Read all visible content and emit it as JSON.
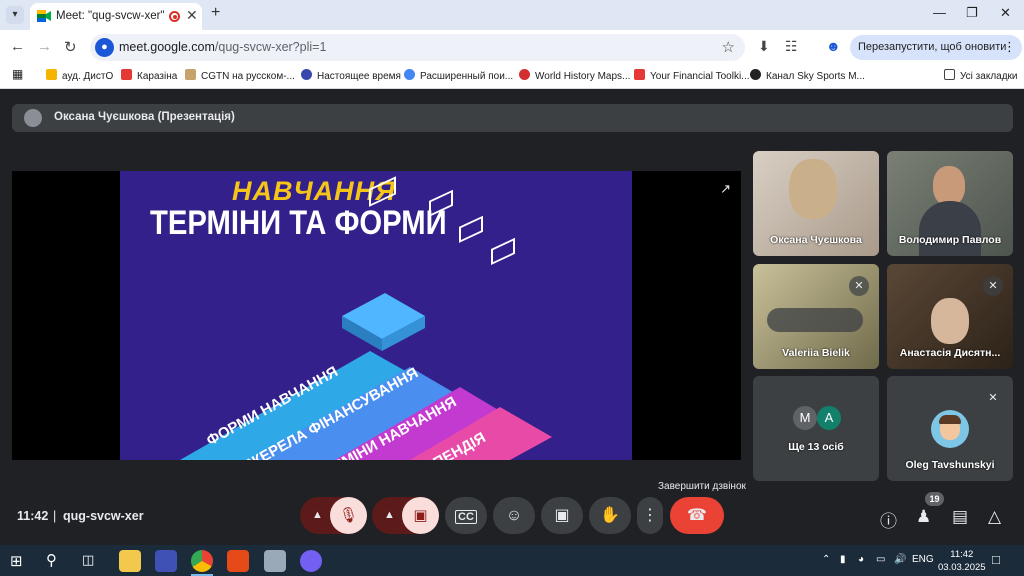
{
  "browser": {
    "tab_title": "Meet: \"qug-svcw-xer\"",
    "tab_menu_icon": "chevron-down-icon",
    "url_host": "meet.google.com",
    "url_path": "/qug-svcw-xer?pli=1",
    "update_button": "Перезапустити, щоб оновити дані",
    "bookmarks": [
      {
        "label": "ауд. ДистО",
        "color": "#f4b400"
      },
      {
        "label": "Каразіна",
        "color": "#e53935"
      },
      {
        "label": "CGTN на русском-...",
        "color": "#c8a26b"
      },
      {
        "label": "Настоящее время",
        "color": "#3949ab"
      },
      {
        "label": "Расширенный пои...",
        "color": "#4285f4"
      },
      {
        "label": "World History Maps...",
        "color": "#d32f2f"
      },
      {
        "label": "Your Financial Toolki...",
        "color": "#e53935"
      },
      {
        "label": "Канал Sky Sports M...",
        "color": "#222222"
      }
    ],
    "all_bookmarks": "Усі закладки"
  },
  "meet": {
    "presenter": "Оксана Чуєшкова (Презентація)",
    "slide": {
      "kicker": "НАВЧАННЯ",
      "heading": "ТЕРМІНИ ТА ФОРМИ",
      "steps": [
        "ФОРМИ НАВЧАННЯ",
        "ДЖЕРЕЛА ФІНАНСУВАННЯ",
        "ТЕРМІНИ НАВЧАННЯ",
        "СТИПЕНДІЯ"
      ]
    },
    "participants": [
      {
        "name": "Оксана Чуєшкова"
      },
      {
        "name": "Володимир Павлов"
      },
      {
        "name": "Valeriia Bielik"
      },
      {
        "name": "Анастасія Дисятн..."
      },
      {
        "name": "Ще 13 осіб",
        "initials": [
          "M",
          "A"
        ]
      },
      {
        "name": "Oleg Tavshunskyi"
      }
    ],
    "tooltip": "Завершити дзвінок",
    "time": "11:42",
    "separator": "|",
    "meeting_code": "qug-svcw-xer",
    "people_count": "19",
    "colors": {
      "end_call": "#ea4335",
      "muted_bg": "#f9dedc"
    }
  },
  "taskbar": {
    "language": "ENG",
    "time": "11:42",
    "date": "03.03.2025"
  }
}
